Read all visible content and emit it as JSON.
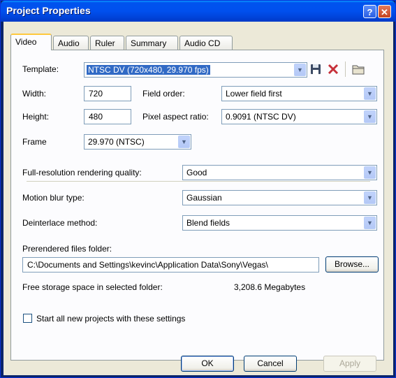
{
  "window": {
    "title": "Project Properties",
    "help_glyph": "?",
    "close_glyph": "✕"
  },
  "tabs": [
    {
      "label": "Video",
      "active": true
    },
    {
      "label": "Audio"
    },
    {
      "label": "Ruler"
    },
    {
      "label": "Summary"
    },
    {
      "label": "Audio CD"
    }
  ],
  "video": {
    "template_label": "Template:",
    "template_value": "NTSC DV (720x480, 29.970 fps)",
    "width_label": "Width:",
    "width_value": "720",
    "height_label": "Height:",
    "height_value": "480",
    "field_order_label": "Field order:",
    "field_order_value": "Lower field first",
    "pixel_aspect_label": "Pixel aspect ratio:",
    "pixel_aspect_value": "0.9091 (NTSC DV)",
    "frame_label": "Frame",
    "frame_value": "29.970 (NTSC)",
    "quality_label": "Full-resolution rendering quality:",
    "quality_value": "Good",
    "motion_blur_label": "Motion blur type:",
    "motion_blur_value": "Gaussian",
    "deinterlace_label": "Deinterlace method:",
    "deinterlace_value": "Blend fields",
    "folder_label": "Prerendered files folder:",
    "folder_value": "C:\\Documents and Settings\\kevinc\\Application Data\\Sony\\Vegas\\",
    "browse_label": "Browse...",
    "free_space_label": "Free storage space in selected folder:",
    "free_space_value": "3,208.6 Megabytes",
    "start_all_label": "Start all new projects with these settings",
    "start_all_checked": false
  },
  "buttons": {
    "ok": "OK",
    "cancel": "Cancel",
    "apply": "Apply"
  },
  "icons": [
    "save-icon",
    "delete-icon",
    "folder-icon",
    "dropdown-arrow-icon"
  ],
  "colors": {
    "titlebar": "#0054e3",
    "dialog_bg": "#ece9d8",
    "selection": "#316ac5",
    "delete": "#c6303a"
  }
}
